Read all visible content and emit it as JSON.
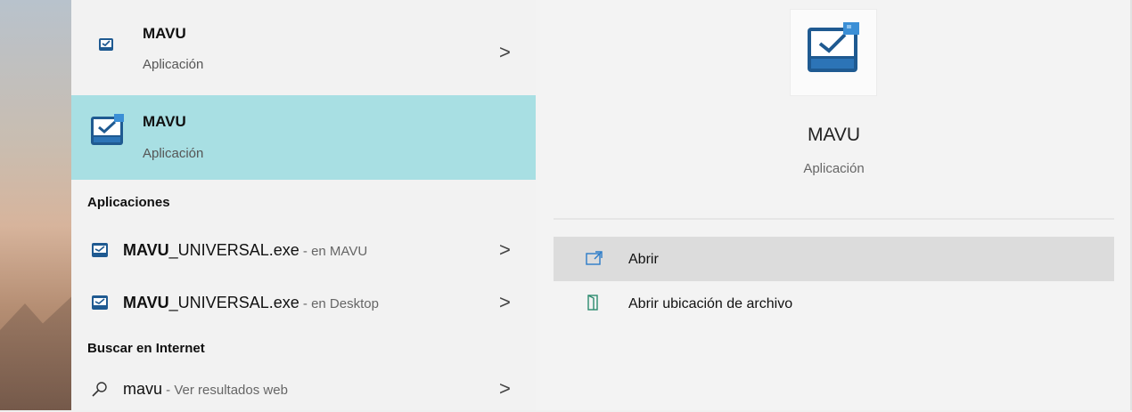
{
  "results": {
    "top_items": [
      {
        "title": "MAVU",
        "subtitle": "Aplicación",
        "chevron": ">"
      },
      {
        "title": "MAVU",
        "subtitle": "Aplicación",
        "selected": true
      }
    ],
    "sections": [
      {
        "header": "Aplicaciones",
        "items": [
          {
            "name_bold": "MAVU",
            "name_rest": "_UNIVERSAL.exe",
            "location": " - en MAVU",
            "chevron": ">"
          },
          {
            "name_bold": "MAVU",
            "name_rest": "_UNIVERSAL.exe",
            "location": " - en Desktop",
            "chevron": ">"
          }
        ]
      },
      {
        "header": "Buscar en Internet",
        "items": [
          {
            "query": "mavu",
            "suffix": " - Ver resultados web",
            "chevron": ">"
          }
        ]
      }
    ]
  },
  "details": {
    "title": "MAVU",
    "subtitle": "Aplicación",
    "actions": [
      {
        "label": "Abrir",
        "icon": "open-icon",
        "hovered": true
      },
      {
        "label": "Abrir ubicación de archivo",
        "icon": "folder-location-icon"
      }
    ]
  },
  "colors": {
    "selected_bg": "#a8dfe3",
    "hover_bg": "#dcdcdc",
    "icon_blue": "#1f5a91",
    "icon_light": "#3b8fd6"
  }
}
